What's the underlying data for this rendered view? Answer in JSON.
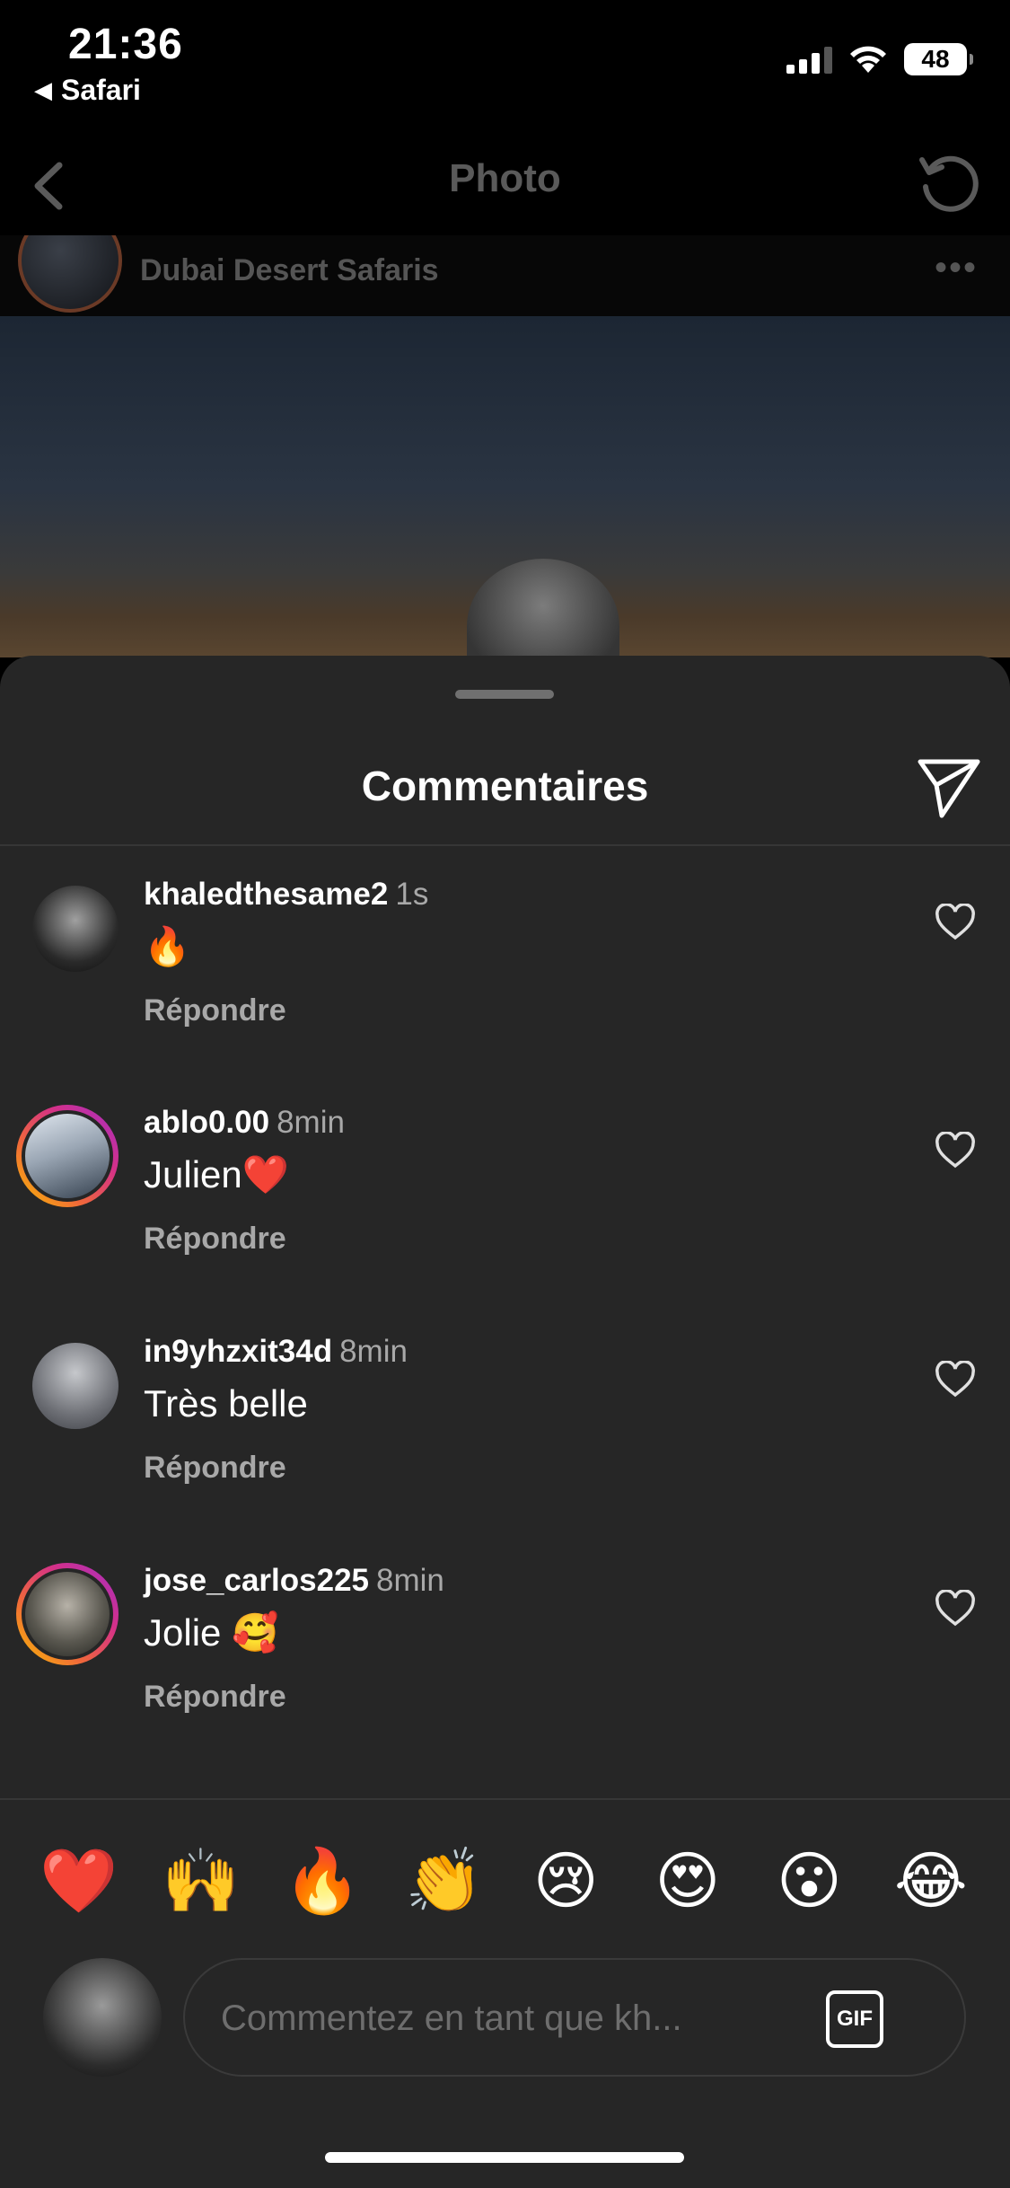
{
  "status_bar": {
    "time": "21:36",
    "back_app": "Safari",
    "battery": "48"
  },
  "navbar": {
    "title": "Photo"
  },
  "post": {
    "location": "Dubai Desert Safaris",
    "more": "•••"
  },
  "comments_sheet": {
    "title": "Commentaires",
    "comments": [
      {
        "username": "khaledthesame2",
        "time": "1s",
        "text": "🔥",
        "reply_label": "Répondre",
        "avatar_ring": false
      },
      {
        "username": "ablo0.00",
        "time": "8min",
        "text": "Julien❤️",
        "reply_label": "Répondre",
        "avatar_ring": true
      },
      {
        "username": "in9yhzxit34d",
        "time": "8min",
        "text": "Très belle",
        "reply_label": "Répondre",
        "avatar_ring": false
      },
      {
        "username": "jose_carlos225",
        "time": "8min",
        "text": "Jolie 🥰",
        "reply_label": "Répondre",
        "avatar_ring": true
      }
    ],
    "quick_emojis": [
      "❤️",
      "🙌",
      "🔥",
      "👏",
      "😢",
      "😍",
      "😮",
      "😂"
    ],
    "input": {
      "placeholder": "Commentez en tant que kh...",
      "gif_label": "GIF"
    }
  },
  "colors": {
    "sheet_bg": "#262626",
    "secondary_text": "#a8a8a8",
    "story_ring": [
      "#f9c200",
      "#f0683a",
      "#d43089",
      "#a32fc6"
    ]
  }
}
